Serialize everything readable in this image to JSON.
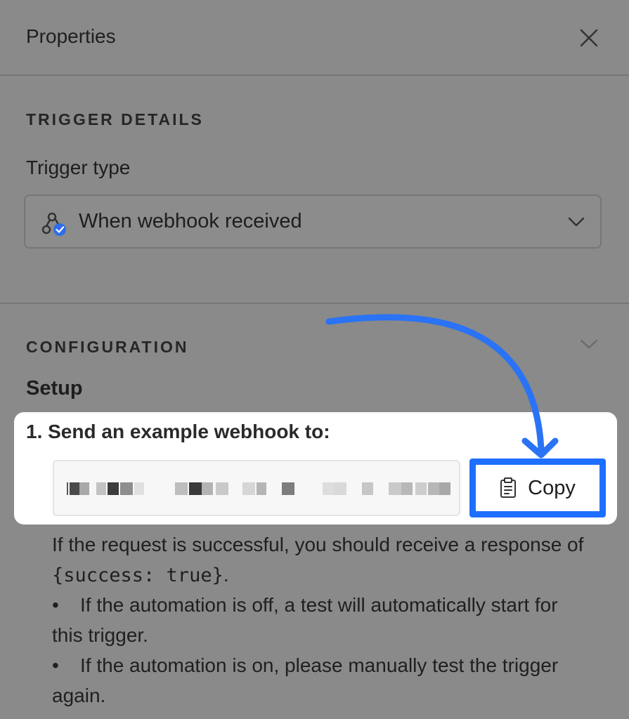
{
  "panel": {
    "title": "Properties"
  },
  "trigger_details": {
    "heading": "TRIGGER DETAILS",
    "trigger_type_label": "Trigger type",
    "selected_trigger": "When webhook received"
  },
  "configuration": {
    "heading": "CONFIGURATION",
    "setup_label": "Setup",
    "step1_label": "1. Send an example webhook to:",
    "copy_label": "Copy",
    "desc_intro": "If the request is successful, you should receive a response of ",
    "desc_code": "{success: true}",
    "desc_end": ".",
    "bullet1": "If the automation is off, a test will automatically start for this trigger.",
    "bullet2": "If the automation is on, please manually test the trigger again.",
    "bullet_char": "•"
  },
  "icons": {
    "close": "close-icon",
    "webhook": "webhook-icon",
    "select_chevron": "chevron-down-icon",
    "config_chevron": "chevron-down-icon",
    "copy": "clipboard-icon",
    "annotation": "arrow-annotation"
  },
  "colors": {
    "overlay_background": "#8a8a8a",
    "highlight_background": "#ffffff",
    "accent_blue": "#1e6fff",
    "verified_badge": "#2f6ee8"
  }
}
